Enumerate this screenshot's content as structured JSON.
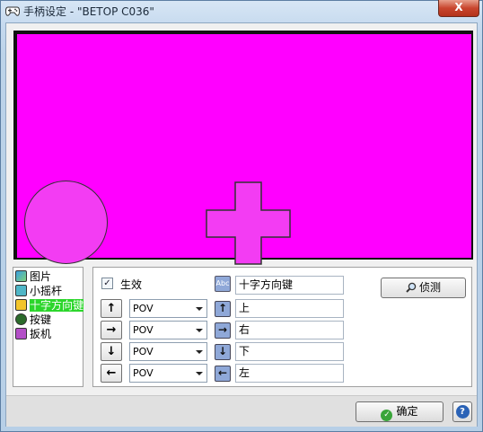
{
  "window": {
    "title": "手柄设定 - \"BETOP C036\"",
    "close_label": "X"
  },
  "colors": {
    "preview_background": "#ff00ff",
    "shape_fill": "#f33cf3",
    "selection": "#2bd62b"
  },
  "tree": {
    "items": [
      {
        "label": "图片",
        "icon": "picture-icon"
      },
      {
        "label": "小摇杆",
        "icon": "thumbstick-icon"
      },
      {
        "label": "十字方向键",
        "icon": "dpad-icon",
        "selected": true
      },
      {
        "label": "按键",
        "icon": "button-icon"
      },
      {
        "label": "扳机",
        "icon": "trigger-icon"
      }
    ]
  },
  "settings": {
    "enabled_checked": "✓",
    "enabled_label": "生效",
    "name_icon_text": "Abc",
    "name_value": "十字方向键",
    "detect_label": "侦测",
    "rows": [
      {
        "arrow": "↑",
        "select": "POV",
        "icon": "↑",
        "value": "上"
      },
      {
        "arrow": "→",
        "select": "POV",
        "icon": "→",
        "value": "右"
      },
      {
        "arrow": "↓",
        "select": "POV",
        "icon": "↓",
        "value": "下"
      },
      {
        "arrow": "←",
        "select": "POV",
        "icon": "←",
        "value": "左"
      }
    ]
  },
  "footer": {
    "ok_icon": "✓",
    "ok_label": "确定",
    "help_label": "?"
  }
}
